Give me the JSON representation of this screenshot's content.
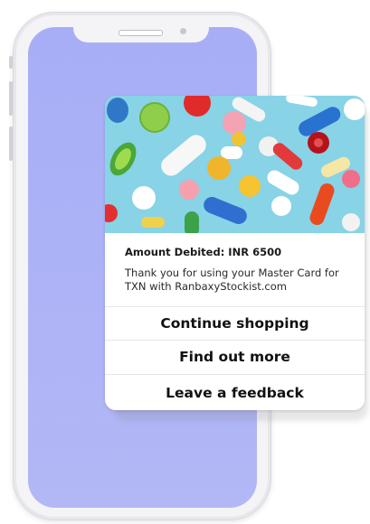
{
  "notification": {
    "image_description_icon": "medicine-pills-photo",
    "amount_text": "Amount Debited: INR 6500",
    "message_text": "Thank you for using your Master Card for TXN with RanbaxyStockist.com"
  },
  "actions": {
    "continue_label": "Continue shopping",
    "find_out_label": "Find out more",
    "feedback_label": "Leave a feedback"
  },
  "colors": {
    "screen": "#a8aef6",
    "card": "#ffffff",
    "image_background": "#8fd6e8"
  }
}
